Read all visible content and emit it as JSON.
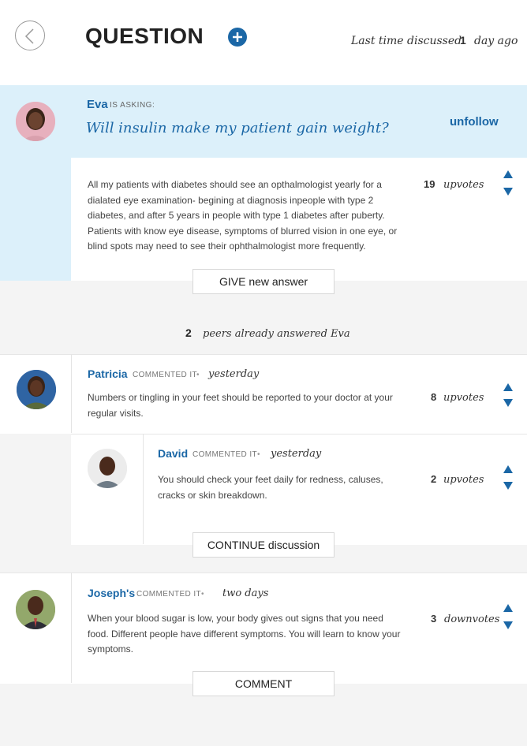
{
  "header": {
    "title": "QUESTION",
    "last_discussed_label": "Last time discussed",
    "last_discussed_count": "1",
    "last_discussed_unit": "day ago"
  },
  "question": {
    "author": "Eva",
    "asking_label": "IS ASKING:",
    "title": "Will insulin make my patient gain weight?",
    "follow_label": "unfollow",
    "body": "All my patients with diabetes should see an opthalmologist yearly for a dialated eye examination- begining at diagnosis inpeople with type 2 diabetes, and after 5 years in people with type 1 diabetes after puberty. Patients with know eye disease, symptoms of blurred vision in one eye, or blind spots may need to see their ophthalmologist more frequently.",
    "votes": "19",
    "votes_label": "upvotes",
    "give_answer_label": "GIVE new answer"
  },
  "answers_summary": {
    "count": "2",
    "label": "peers already answered Eva"
  },
  "answers": [
    {
      "author": "Patricia",
      "commented_label": "COMMENTED IT",
      "separator": "•",
      "when": "yesterday",
      "body": "Numbers or tingling in your feet should be reported to your doctor at your regular visits.",
      "votes": "8",
      "votes_label": "upvotes",
      "reply": {
        "author": "David",
        "commented_label": "COMMENTED IT",
        "separator": "•",
        "when": "yesterday",
        "body": "You should check your feet daily for redness, caluses, cracks or skin breakdown.",
        "votes": "2",
        "votes_label": "upvotes"
      },
      "continue_label": "CONTINUE discussion"
    },
    {
      "author": "Joseph's",
      "commented_label": "COMMENTED IT",
      "separator": "•",
      "when": "two days",
      "body": "When your blood sugar is low, your body gives out signs that you need food. Different people have different symptoms. You will learn to know your symptoms.",
      "votes": "3",
      "votes_label": "downvotes",
      "comment_label": "COMMENT"
    }
  ],
  "icons": {
    "back": "chevron-left-icon",
    "add": "plus-circle-icon",
    "up": "triangle-up-icon",
    "down": "triangle-down-icon"
  },
  "colors": {
    "accent": "#1b67a6",
    "question_bg": "#dcf0fa",
    "page_bg": "#f4f4f4"
  }
}
